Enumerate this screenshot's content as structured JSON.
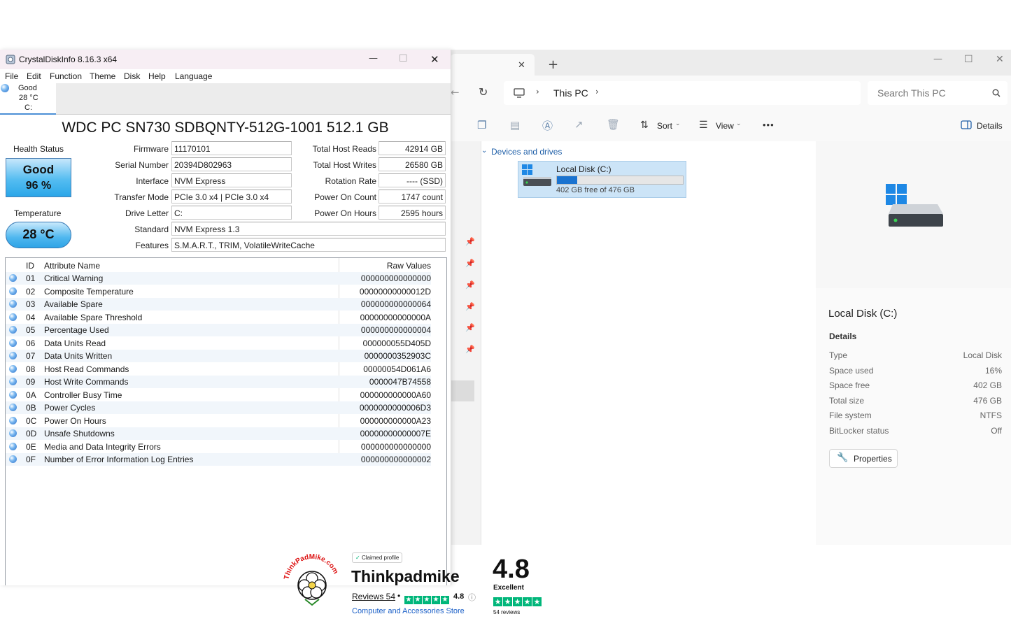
{
  "explorer": {
    "tab_close": "✕",
    "tab_add": "+",
    "window_controls": {
      "minimize": "—",
      "maximize": "☐",
      "close": "✕"
    },
    "breadcrumb": [
      "This PC"
    ],
    "search_placeholder": "Search This PC",
    "toolbar": {
      "sort": "Sort",
      "view": "View",
      "more": "•••",
      "details": "Details"
    },
    "section_header": "Devices and drives",
    "drive": {
      "name": "Local Disk (C:)",
      "free_text": "402 GB free of 476 GB",
      "used_fraction": 0.16
    },
    "details_pane": {
      "title": "Local Disk (C:)",
      "heading": "Details",
      "rows": [
        {
          "label": "Type",
          "value": "Local Disk"
        },
        {
          "label": "Space used",
          "value": "16%"
        },
        {
          "label": "Space free",
          "value": "402 GB"
        },
        {
          "label": "Total size",
          "value": "476 GB"
        },
        {
          "label": "File system",
          "value": "NTFS"
        },
        {
          "label": "BitLocker status",
          "value": "Off"
        }
      ],
      "properties_button": "Properties"
    }
  },
  "cdi": {
    "title": "CrystalDiskInfo 8.16.3 x64",
    "window_controls": {
      "minimize": "—",
      "maximize": "☐",
      "close": "✕"
    },
    "menu": [
      "File",
      "Edit",
      "Function",
      "Theme",
      "Disk",
      "Help",
      "Language"
    ],
    "disk_tab": {
      "status": "Good",
      "temp": "28 °C",
      "drive": "C:"
    },
    "model": "WDC PC SN730 SDBQNTY-512G-1001 512.1 GB",
    "health_label": "Health Status",
    "health_status": "Good",
    "health_percent": "96 %",
    "temperature_label": "Temperature",
    "temperature": "28 °C",
    "info_left": [
      {
        "label": "Firmware",
        "value": "11170101"
      },
      {
        "label": "Serial Number",
        "value": "20394D802963"
      },
      {
        "label": "Interface",
        "value": "NVM Express"
      },
      {
        "label": "Transfer Mode",
        "value": "PCIe 3.0 x4 | PCIe 3.0 x4"
      },
      {
        "label": "Drive Letter",
        "value": "C:"
      }
    ],
    "info_right": [
      {
        "label": "Total Host Reads",
        "value": "42914 GB"
      },
      {
        "label": "Total Host Writes",
        "value": "26580 GB"
      },
      {
        "label": "Rotation Rate",
        "value": "---- (SSD)"
      },
      {
        "label": "Power On Count",
        "value": "1747 count"
      },
      {
        "label": "Power On Hours",
        "value": "2595 hours"
      }
    ],
    "standard_label": "Standard",
    "standard_value": "NVM Express 1.3",
    "features_label": "Features",
    "features_value": "S.M.A.R.T., TRIM, VolatileWriteCache",
    "table_headers": {
      "id": "ID",
      "name": "Attribute Name",
      "raw": "Raw Values"
    },
    "attributes": [
      {
        "id": "01",
        "name": "Critical Warning",
        "raw": "000000000000000"
      },
      {
        "id": "02",
        "name": "Composite Temperature",
        "raw": "00000000000012D"
      },
      {
        "id": "03",
        "name": "Available Spare",
        "raw": "000000000000064"
      },
      {
        "id": "04",
        "name": "Available Spare Threshold",
        "raw": "00000000000000A"
      },
      {
        "id": "05",
        "name": "Percentage Used",
        "raw": "000000000000004"
      },
      {
        "id": "06",
        "name": "Data Units Read",
        "raw": "000000055D405D"
      },
      {
        "id": "07",
        "name": "Data Units Written",
        "raw": "0000000352903C"
      },
      {
        "id": "08",
        "name": "Host Read Commands",
        "raw": "00000054D061A6"
      },
      {
        "id": "09",
        "name": "Host Write Commands",
        "raw": "0000047B74558"
      },
      {
        "id": "0A",
        "name": "Controller Busy Time",
        "raw": "000000000000A60"
      },
      {
        "id": "0B",
        "name": "Power Cycles",
        "raw": "0000000000006D3"
      },
      {
        "id": "0C",
        "name": "Power On Hours",
        "raw": "000000000000A23"
      },
      {
        "id": "0D",
        "name": "Unsafe Shutdowns",
        "raw": "00000000000007E"
      },
      {
        "id": "0E",
        "name": "Media and Data Integrity Errors",
        "raw": "000000000000000"
      },
      {
        "id": "0F",
        "name": "Number of Error Information Log Entries",
        "raw": "000000000000002"
      }
    ]
  },
  "trustpilot": {
    "logo_text": "ThinkPadMike.com",
    "claimed": "Claimed profile",
    "company": "Thinkpadmike",
    "reviews_link": "Reviews 54",
    "rating_small": "4.8",
    "category": "Computer and Accessories Store",
    "rating_big": "4.8",
    "rating_word": "Excellent",
    "reviews_count": "54 reviews",
    "stars": 5
  }
}
